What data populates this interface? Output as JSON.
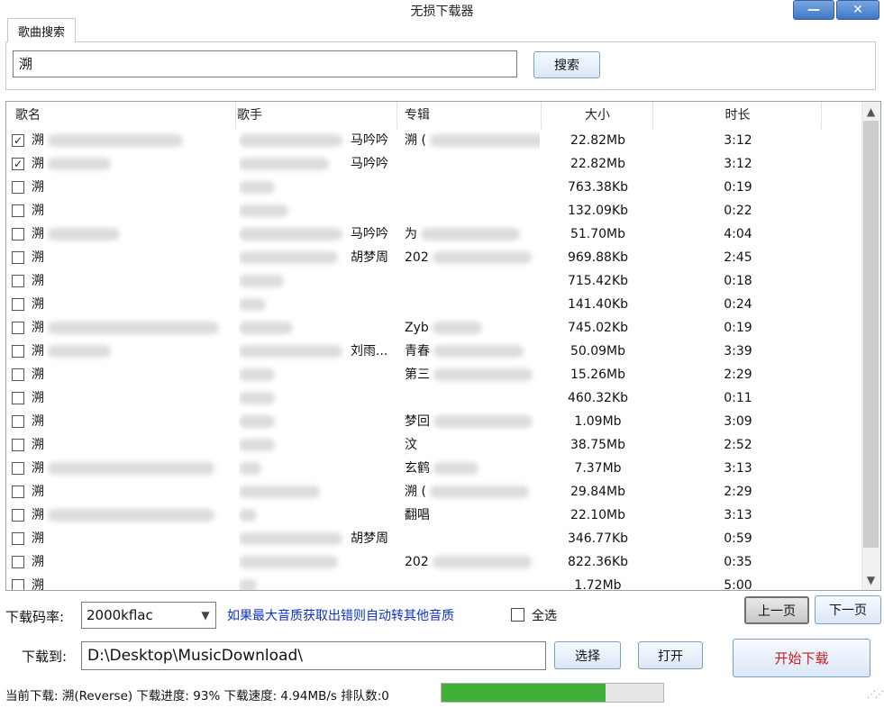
{
  "window": {
    "title": "无损下载器",
    "minimize_glyph": "—",
    "close_glyph": "✕",
    "minimize_icon": "minimize-icon",
    "close_icon": "close-icon"
  },
  "search": {
    "tab_label": "歌曲搜索",
    "value": "溯",
    "button_label": "搜索"
  },
  "table": {
    "columns": [
      "歌名",
      "歌手",
      "专辑",
      "大小",
      "时长"
    ],
    "rows": [
      {
        "checked": true,
        "name": "溯",
        "singer": "马吟吟",
        "album": "溯 (",
        "size": "22.82Mb",
        "duration": "3:12"
      },
      {
        "checked": true,
        "name": "溯",
        "singer": "马吟吟",
        "album": "",
        "size": "22.82Mb",
        "duration": "3:12"
      },
      {
        "checked": false,
        "name": "溯",
        "singer": "",
        "album": "",
        "size": "763.38Kb",
        "duration": "0:19"
      },
      {
        "checked": false,
        "name": "溯",
        "singer": "",
        "album": "",
        "size": "132.09Kb",
        "duration": "0:22"
      },
      {
        "checked": false,
        "name": "溯",
        "singer": "马吟吟",
        "album": "为",
        "size": "51.70Mb",
        "duration": "4:04"
      },
      {
        "checked": false,
        "name": "溯",
        "singer": "胡梦周",
        "album": "202",
        "size": "969.88Kb",
        "duration": "2:45"
      },
      {
        "checked": false,
        "name": "溯",
        "singer": "",
        "album": "",
        "size": "715.42Kb",
        "duration": "0:18"
      },
      {
        "checked": false,
        "name": "溯",
        "singer": "",
        "album": "",
        "size": "141.40Kb",
        "duration": "0:24"
      },
      {
        "checked": false,
        "name": "溯",
        "singer": "",
        "album": "Zyb",
        "size": "745.02Kb",
        "duration": "0:19"
      },
      {
        "checked": false,
        "name": "溯",
        "singer": "刘雨...",
        "album": "青春",
        "size": "50.09Mb",
        "duration": "3:39"
      },
      {
        "checked": false,
        "name": "溯",
        "singer": "",
        "album": "第三",
        "size": "15.26Mb",
        "duration": "2:29"
      },
      {
        "checked": false,
        "name": "溯",
        "singer": "",
        "album": "",
        "size": "460.32Kb",
        "duration": "0:11"
      },
      {
        "checked": false,
        "name": "溯",
        "singer": "",
        "album": "梦回",
        "size": "1.09Mb",
        "duration": "3:09"
      },
      {
        "checked": false,
        "name": "溯",
        "singer": "",
        "album": "汶",
        "size": "38.75Mb",
        "duration": "2:52"
      },
      {
        "checked": false,
        "name": "溯",
        "singer": "",
        "album": "玄鹤",
        "size": "7.37Mb",
        "duration": "3:13"
      },
      {
        "checked": false,
        "name": "溯",
        "singer": "",
        "album": "溯 (",
        "size": "29.84Mb",
        "duration": "2:29"
      },
      {
        "checked": false,
        "name": "溯",
        "singer": "",
        "album": "翻唱",
        "size": "22.10Mb",
        "duration": "3:13"
      },
      {
        "checked": false,
        "name": "溯",
        "singer": "胡梦周",
        "album": "",
        "size": "346.77Kb",
        "duration": "0:59"
      },
      {
        "checked": false,
        "name": "溯",
        "singer": "",
        "album": "202",
        "size": "822.36Kb",
        "duration": "0:35"
      },
      {
        "checked": false,
        "name": "溯",
        "singer": "",
        "album": "",
        "size": "1.72Mb",
        "duration": "5:00"
      }
    ]
  },
  "controls": {
    "rate_label": "下载码率:",
    "rate_value": "2000kflac",
    "rate_hint": "如果最大音质获取出错则自动转其他音质",
    "select_all_label": "全选",
    "prev_label": "上一页",
    "next_label": "下一页",
    "path_label": "下载到:",
    "path_value": "D:\\Desktop\\MusicDownload\\",
    "choose_label": "选择",
    "open_label": "打开",
    "start_label": "开始下载"
  },
  "status": {
    "text": "当前下载: 溯(Reverse) 下载进度: 93% 下载速度: 4.94MB/s 排队数:0",
    "progress": 0.74,
    "progress_color": "#41b038"
  }
}
